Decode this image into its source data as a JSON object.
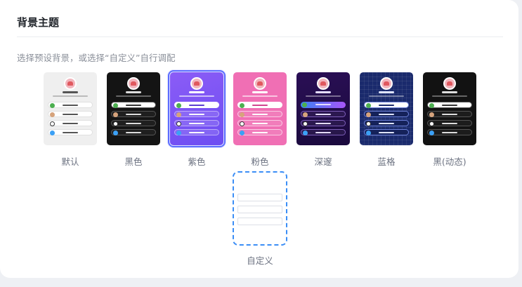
{
  "panel": {
    "title": "背景主题",
    "hint": "选择预设背景，或选择“自定义”自行调配"
  },
  "themes": [
    {
      "id": "default",
      "label": "默认",
      "selected": false
    },
    {
      "id": "black",
      "label": "黑色",
      "selected": false
    },
    {
      "id": "purple",
      "label": "紫色",
      "selected": true
    },
    {
      "id": "pink",
      "label": "粉色",
      "selected": false
    },
    {
      "id": "deep",
      "label": "深邃",
      "selected": false
    },
    {
      "id": "blue",
      "label": "蓝格",
      "selected": false
    },
    {
      "id": "blackdyn",
      "label": "黑(动态)",
      "selected": false
    }
  ],
  "custom": {
    "label": "自定义"
  },
  "colors": {
    "accent": "#5b6cff",
    "custom_border": "#3b8ef6",
    "title": "#1f2329",
    "muted": "#8a8f99"
  }
}
